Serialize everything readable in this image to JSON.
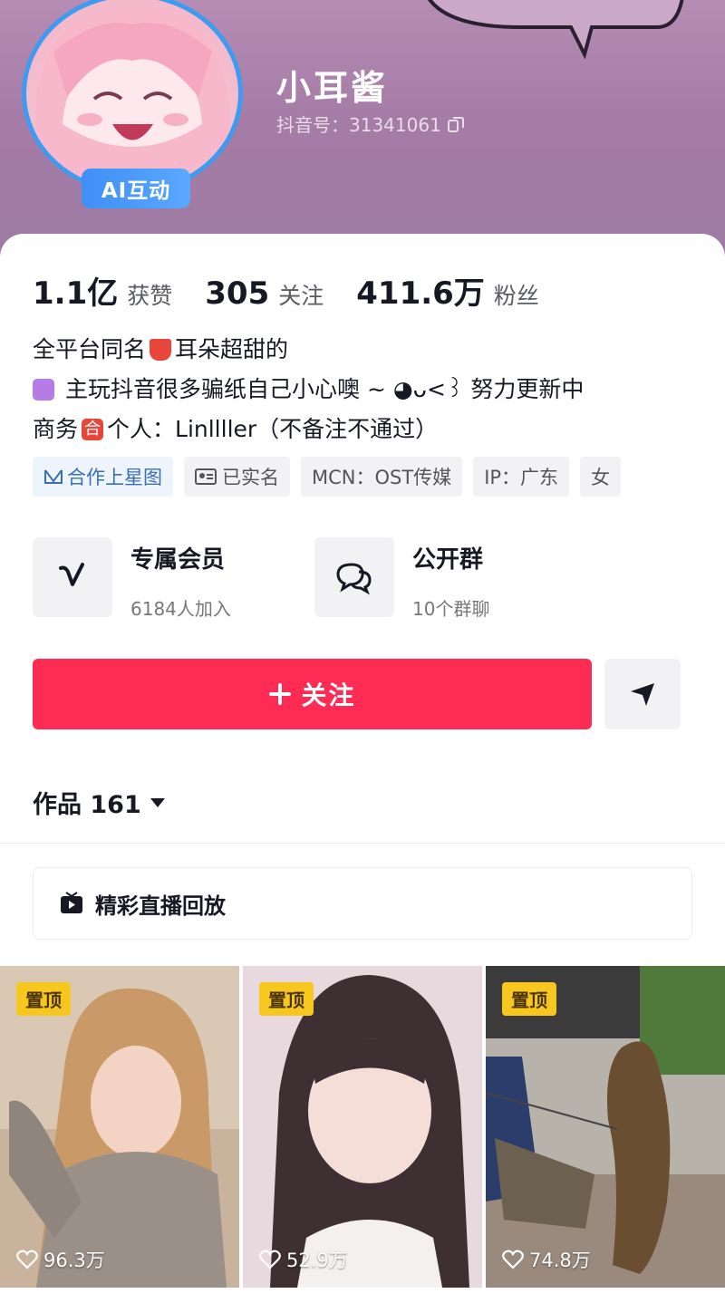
{
  "profile": {
    "nickname": "小耳酱",
    "douyin_id": "抖音号：31341061",
    "ai_badge": "AI互动"
  },
  "stats": [
    {
      "value": "1.1亿",
      "label": "获赞"
    },
    {
      "value": "305",
      "label": "关注"
    },
    {
      "value": "411.6万",
      "label": "粉丝"
    }
  ],
  "bio": {
    "line1_a": "全平台同名",
    "line1_b": "耳朵超甜的",
    "line2": "主玩抖音很多骗纸自己小心噢 ~ ◕ᴗ<꒱ 努力更新中",
    "line3_a": "商务",
    "line3_b": "个人：Linllller（不备注不通过）"
  },
  "tags": [
    {
      "icon": "star-map-icon",
      "label": "合作上星图"
    },
    {
      "icon": "id-card-icon",
      "label": "已实名"
    },
    {
      "icon": "",
      "label": "MCN：OST传媒"
    },
    {
      "icon": "",
      "label": "IP：广东"
    },
    {
      "icon": "",
      "label": "女"
    }
  ],
  "features": [
    {
      "icon": "vip-v-icon",
      "title": "专属会员",
      "subtitle": "6184人加入"
    },
    {
      "icon": "group-chat-icon",
      "title": "公开群",
      "subtitle": "10个群聊"
    }
  ],
  "actions": {
    "follow_label": "关注",
    "follow_icon": "plus-icon",
    "share_icon": "share-arrow-icon"
  },
  "works": {
    "label": "作品 161"
  },
  "replay": {
    "label": "精彩直播回放",
    "icon": "tv-icon"
  },
  "videos": [
    {
      "pinned": "置顶",
      "likes": "96.3万"
    },
    {
      "pinned": "置顶",
      "likes": "52.9万"
    },
    {
      "pinned": "置顶",
      "likes": "74.8万"
    }
  ],
  "colors": {
    "accent_red": "#fe2c55",
    "ai_blue": "#3f8ff7",
    "pin_yellow": "#f8c71f",
    "header_purple": "#a57ca6"
  }
}
